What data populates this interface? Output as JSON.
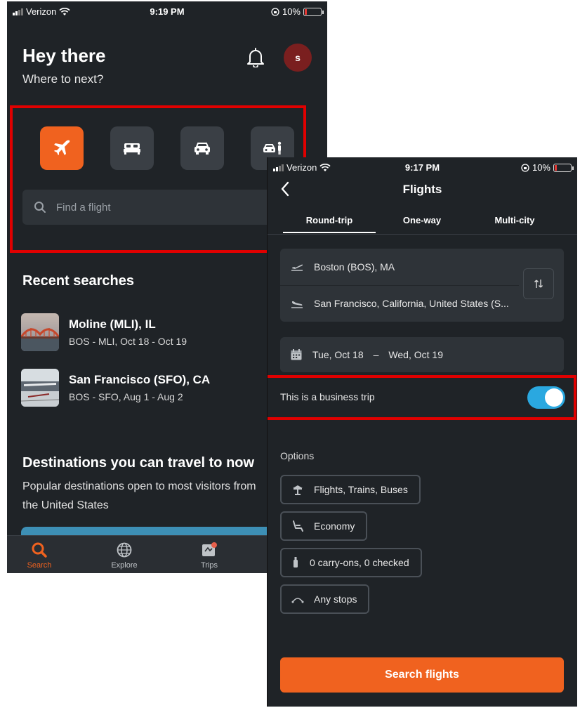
{
  "left_phone": {
    "status": {
      "carrier": "Verizon",
      "time": "9:19 PM",
      "battery": "10%"
    },
    "greeting": "Hey there",
    "greeting_sub": "Where to next?",
    "avatar_initial": "s",
    "categories": [
      {
        "icon": "airplane-icon",
        "active": true
      },
      {
        "icon": "bed-icon",
        "active": false
      },
      {
        "icon": "car-icon",
        "active": false
      },
      {
        "icon": "car-person-icon",
        "active": false
      }
    ],
    "search_placeholder": "Find a flight",
    "recent_title": "Recent searches",
    "recent": [
      {
        "place": "Moline (MLI), IL",
        "dates": "BOS - MLI, Oct 18 - Oct 19"
      },
      {
        "place": "San Francisco (SFO), CA",
        "dates": "BOS - SFO, Aug 1 - Aug 2"
      }
    ],
    "destinations_title": "Destinations you can travel to now",
    "destinations_sub": "Popular destinations open to most visitors from the United States",
    "tabs": [
      {
        "label": "Search",
        "icon": "search-icon",
        "active": true
      },
      {
        "label": "Explore",
        "icon": "globe-icon",
        "active": false
      },
      {
        "label": "Trips",
        "icon": "trips-icon",
        "active": false
      }
    ]
  },
  "right_phone": {
    "status": {
      "carrier": "Verizon",
      "time": "9:17 PM",
      "battery": "10%"
    },
    "title": "Flights",
    "trip_tabs": [
      "Round-trip",
      "One-way",
      "Multi-city"
    ],
    "origin": "Boston (BOS), MA",
    "destination": "San Francisco, California, United States (S...",
    "depart": "Tue, Oct 18",
    "date_sep": "–",
    "return": "Wed, Oct 19",
    "business_label": "This is a business trip",
    "business_on": true,
    "options_label": "Options",
    "options": [
      {
        "label": "Flights, Trains, Buses",
        "icon": "transport-icon"
      },
      {
        "label": "Economy",
        "icon": "seat-icon"
      },
      {
        "label": "0 carry-ons, 0 checked",
        "icon": "luggage-icon"
      },
      {
        "label": "Any stops",
        "icon": "stops-icon"
      }
    ],
    "search_button": "Search flights"
  },
  "colors": {
    "background": "#1f2327",
    "accent": "#f0621f",
    "toggle": "#2aa8e0",
    "highlight": "#e00000"
  }
}
